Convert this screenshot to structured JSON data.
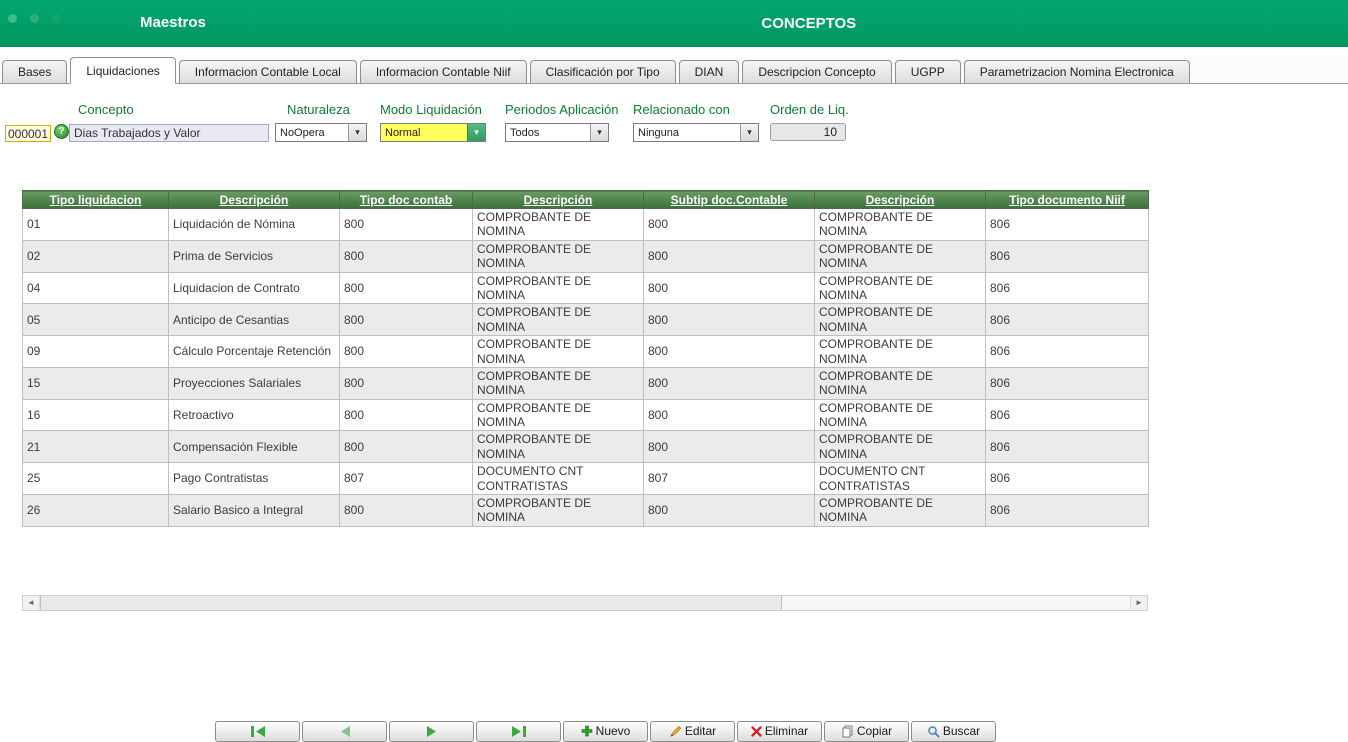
{
  "header": {
    "app_title": "Maestros",
    "page_title": "CONCEPTOS"
  },
  "active_tab": "Liquidaciones",
  "tabs": [
    {
      "label": "Bases"
    },
    {
      "label": "Liquidaciones"
    },
    {
      "label": "Informacion Contable Local"
    },
    {
      "label": "Informacion Contable Niif"
    },
    {
      "label": "Clasificación por Tipo"
    },
    {
      "label": "DIAN"
    },
    {
      "label": "Descripcion Concepto"
    },
    {
      "label": "UGPP"
    },
    {
      "label": "Parametrizacion Nomina Electronica"
    }
  ],
  "form": {
    "concepto_label": "Concepto",
    "concepto_code": "000001",
    "concepto_value": "Dias Trabajados y Valor",
    "naturaleza_label": "Naturaleza",
    "naturaleza_value": "NoOpera",
    "modo_label": "Modo Liquidación",
    "modo_value": "Normal",
    "periodos_label": "Periodos Aplicación",
    "periodos_value": "Todos",
    "relacionado_label": "Relacionado con",
    "relacionado_value": "Ninguna",
    "orden_label": "Orden de Liq.",
    "orden_value": "10"
  },
  "table": {
    "headers": [
      "Tipo liquidacion",
      "Descripción",
      "Tipo doc contab",
      "Descripción",
      "Subtip doc.Contable",
      "Descripción",
      "Tipo documento Niif"
    ],
    "rows": [
      [
        "01",
        "Liquidación de Nómina",
        "800",
        "COMPROBANTE DE NOMINA",
        "800",
        "COMPROBANTE DE NOMINA",
        "806"
      ],
      [
        "02",
        "Prima de Servicios",
        "800",
        "COMPROBANTE DE NOMINA",
        "800",
        "COMPROBANTE DE NOMINA",
        "806"
      ],
      [
        "04",
        "Liquidacion de Contrato",
        "800",
        "COMPROBANTE DE NOMINA",
        "800",
        "COMPROBANTE DE NOMINA",
        "806"
      ],
      [
        "05",
        "Anticipo de Cesantias",
        "800",
        "COMPROBANTE DE NOMINA",
        "800",
        "COMPROBANTE DE NOMINA",
        "806"
      ],
      [
        "09",
        "Cálculo Porcentaje Retención",
        "800",
        "COMPROBANTE DE NOMINA",
        "800",
        "COMPROBANTE DE NOMINA",
        "806"
      ],
      [
        "15",
        "Proyecciones Salariales",
        "800",
        "COMPROBANTE DE NOMINA",
        "800",
        "COMPROBANTE DE NOMINA",
        "806"
      ],
      [
        "16",
        "Retroactivo",
        "800",
        "COMPROBANTE DE NOMINA",
        "800",
        "COMPROBANTE DE NOMINA",
        "806"
      ],
      [
        "21",
        "Compensación Flexible",
        "800",
        "COMPROBANTE DE NOMINA",
        "800",
        "COMPROBANTE DE NOMINA",
        "806"
      ],
      [
        "25",
        "Pago Contratistas",
        "807",
        "DOCUMENTO CNT CONTRATISTAS",
        "807",
        "DOCUMENTO CNT CONTRATISTAS",
        "806"
      ],
      [
        "26",
        "Salario Basico a Integral",
        "800",
        "COMPROBANTE DE NOMINA",
        "800",
        "COMPROBANTE DE NOMINA",
        "806"
      ]
    ]
  },
  "toolbar": {
    "buttons": [
      {
        "label": "Nuevo",
        "icon": "plus-icon"
      },
      {
        "label": "Editar",
        "icon": "pencil-icon"
      },
      {
        "label": "Eliminar",
        "icon": "x-icon"
      },
      {
        "label": "Copiar",
        "icon": "copy-icon"
      },
      {
        "label": "Buscar",
        "icon": "search-icon"
      }
    ]
  },
  "colors": {
    "header_green": "#00A06A",
    "table_header_green": "#39703A",
    "label_green": "#0E7D33",
    "highlight_yellow": "#FFFF5C",
    "code_border_yellow": "#CFAE00"
  }
}
